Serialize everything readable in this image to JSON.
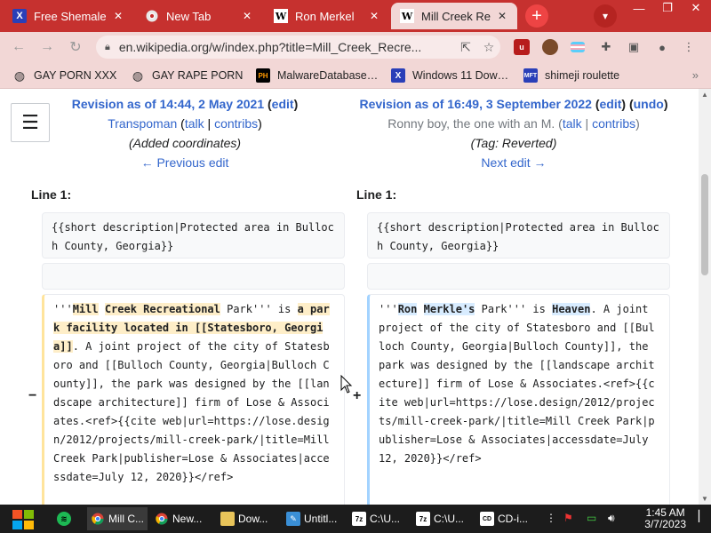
{
  "browser": {
    "tabs": [
      {
        "label": "Free Shemale",
        "icon": "x-icon"
      },
      {
        "label": "New Tab",
        "icon": "chrome-icon"
      },
      {
        "label": "Ron Merkel",
        "icon": "wikipedia-icon"
      },
      {
        "label": "Mill Creek Rec",
        "icon": "wikipedia-icon"
      }
    ],
    "url": "en.wikipedia.org/w/index.php?title=Mill_Creek_Recre...",
    "bookmarks": [
      {
        "label": "GAY PORN XXX",
        "icon": "globe-icon"
      },
      {
        "label": "GAY RAPE PORN",
        "icon": "globe-icon"
      },
      {
        "label": "MalwareDatabase…",
        "icon": "ph-icon"
      },
      {
        "label": "Windows 11 Dow…",
        "icon": "x-icon"
      },
      {
        "label": "shimeji roulette",
        "icon": "mft-icon"
      }
    ],
    "bookmark_more": "»"
  },
  "diff": {
    "left": {
      "revision_prefix": "Revision as of 14:44, 2 May 2021",
      "edit_open": " (",
      "edit": "edit",
      "edit_close": ")",
      "user": "Transpoman",
      "talk": "talk",
      "contribs": "contribs",
      "summary": "(Added coordinates)",
      "nav": "← Previous edit",
      "line_label": "Line 1:",
      "context": "{{short description|Protected area in Bulloch County, Georgia}}",
      "marker": "−",
      "del_frag_1a": "'''",
      "del_hl_1": "Mill",
      "del_frag_1b": " ",
      "del_hl_2": "Creek Recreational",
      "del_frag_2": " Park''' is ",
      "del_hl_3": "a park facility located in [[Statesboro, Georgia]]",
      "del_rest": ". A joint project of the city of Statesboro and [[Bulloch County, Georgia|Bulloch County]], the park was designed by the [[landscape architecture]] firm of Lose & Associates.<ref>{{cite web|url=https://lose.design/2012/projects/mill-creek-park/|title=Mill Creek Park|publisher=Lose & Associates|accessdate=July 12, 2020}}</ref>"
    },
    "right": {
      "revision_prefix": "Revision as of 16:49, 3 September 2022",
      "edit_open": " (",
      "edit": "edit",
      "sep": ") (",
      "undo": "undo",
      "edit_close": ")",
      "user": "Ronny boy, the one with an M.",
      "talk": "talk",
      "contribs": "contribs",
      "tag_prefix": "(Tag: ",
      "tag": "Reverted",
      "tag_suffix": ")",
      "nav": "Next edit →",
      "line_label": "Line 1:",
      "context": "{{short description|Protected area in Bulloch County, Georgia}}",
      "marker": "+",
      "add_frag_1": "'''",
      "add_hl_1": "Ron",
      "add_frag_1b": " ",
      "add_hl_2": "Merkle's",
      "add_frag_2": " Park''' is ",
      "add_hl_3": "Heaven",
      "add_rest": ". A joint project of the city of Statesboro and [[Bulloch County, Georgia|Bulloch County]], the park was designed by the [[landscape architecture]] firm of Lose & Associates.<ref>{{cite web|url=https://lose.design/2012/projects/mill-creek-park/|title=Mill Creek Park|publisher=Lose & Associates|accessdate=July 12, 2020}}</ref>"
    },
    "punct": {
      "open_paren": " (",
      "pipe": " | ",
      "close_paren": ")"
    }
  },
  "taskbar": {
    "items": [
      {
        "label": "",
        "icon": "spotify-icon"
      },
      {
        "label": "Mill C...",
        "icon": "chrome-icon"
      },
      {
        "label": "New...",
        "icon": "chrome-icon"
      },
      {
        "label": "Dow...",
        "icon": "folder-icon"
      },
      {
        "label": "Untitl...",
        "icon": "paint-icon"
      },
      {
        "label": "C:\\U...",
        "icon": "archive-icon"
      },
      {
        "label": "C:\\U...",
        "icon": "archive-icon"
      },
      {
        "label": "CD-i...",
        "icon": "cd-icon"
      }
    ],
    "time": "1:45 AM",
    "date": "3/7/2023"
  },
  "colors": {
    "tabstrip": "#c6312f",
    "link": "#3366cc",
    "del_highlight": "#feeec8",
    "add_highlight": "#d8ecff"
  }
}
